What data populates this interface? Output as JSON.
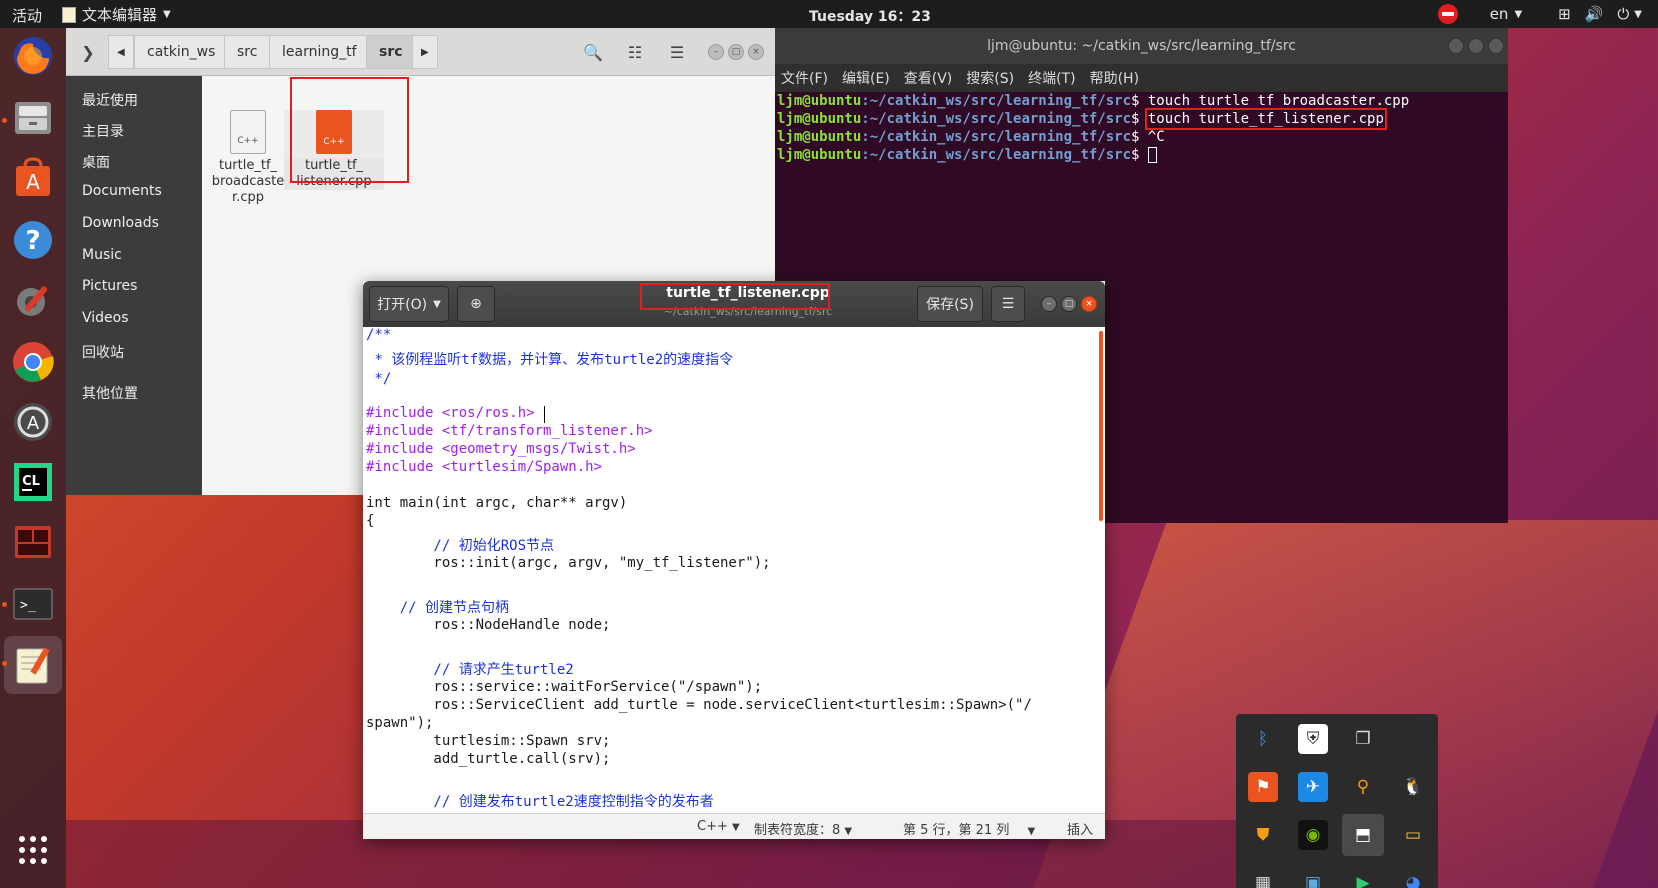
{
  "top_panel": {
    "activities": "活动",
    "app_menu": "文本编辑器",
    "clock": "Tuesday 16：23",
    "lang": "en"
  },
  "dock": {
    "items": [
      "firefox",
      "files",
      "software",
      "help",
      "settings",
      "chrome",
      "update",
      "clion",
      "terminal-app",
      "terminal",
      "text-editor",
      "show-apps"
    ]
  },
  "files": {
    "path": [
      "catkin_ws",
      "src",
      "learning_tf",
      "src"
    ],
    "sidebar": [
      "最近使用",
      "主目录",
      "桌面",
      "Documents",
      "Downloads",
      "Music",
      "Pictures",
      "Videos",
      "回收站",
      "其他位置"
    ],
    "items": [
      {
        "name": "turtle_tf_\nbroadcaste\nr.cpp",
        "icon_label": "C++"
      },
      {
        "name": "turtle_tf_\nlistener.cpp",
        "icon_label": "C++"
      }
    ]
  },
  "terminal": {
    "title": "ljm@ubuntu: ~/catkin_ws/src/learning_tf/src",
    "menu": [
      "文件(F)",
      "编辑(E)",
      "查看(V)",
      "搜索(S)",
      "终端(T)",
      "帮助(H)"
    ],
    "user": "ljm@ubuntu",
    "path": ":~/catkin_ws/src/learning_tf/src",
    "lines": [
      {
        "cmd": "touch turtle_tf_broadcaster.cpp"
      },
      {
        "cmd": "touch turtle_tf_listener.cpp"
      },
      {
        "cmd": "^C"
      },
      {
        "cmd": ""
      }
    ]
  },
  "gedit": {
    "open_label": "打开(O)",
    "save_label": "保存(S)",
    "title": "turtle_tf_listener.cpp",
    "subtitle": "~/catkin_ws/src/learning_tf/src",
    "code": [
      "/**",
      " * 该例程监听tf数据，并计算、发布turtle2的速度指令",
      " */",
      "",
      "#include <ros/ros.h>",
      "#include <tf/transform_listener.h>",
      "#include <geometry_msgs/Twist.h>",
      "#include <turtlesim/Spawn.h>",
      "",
      "int main(int argc, char** argv)",
      "{",
      "        // 初始化ROS节点",
      "        ros::init(argc, argv, \"my_tf_listener\");",
      "",
      "    // 创建节点句柄",
      "        ros::NodeHandle node;",
      "",
      "        // 请求产生turtle2",
      "        ros::service::waitForService(\"/spawn\");",
      "        ros::ServiceClient add_turtle = node.serviceClient<turtlesim::Spawn>(\"/",
      "spawn\");",
      "        turtlesim::Spawn srv;",
      "        add_turtle.call(srv);",
      "",
      "        // 创建发布turtle2速度控制指令的发布者"
    ],
    "status": {
      "language": "C++",
      "tab_width": "制表符宽度：8",
      "position": "第 5 行，第 21 列",
      "mode": "插入"
    }
  },
  "tray": {
    "icons": [
      "bluetooth",
      "shield",
      "copy-window",
      "anydesk",
      "teamviewer",
      "search",
      "tux",
      "vpn",
      "nvidia",
      "bookmark",
      "window",
      "calendar",
      "photos",
      "play",
      "chrome-small"
    ]
  }
}
